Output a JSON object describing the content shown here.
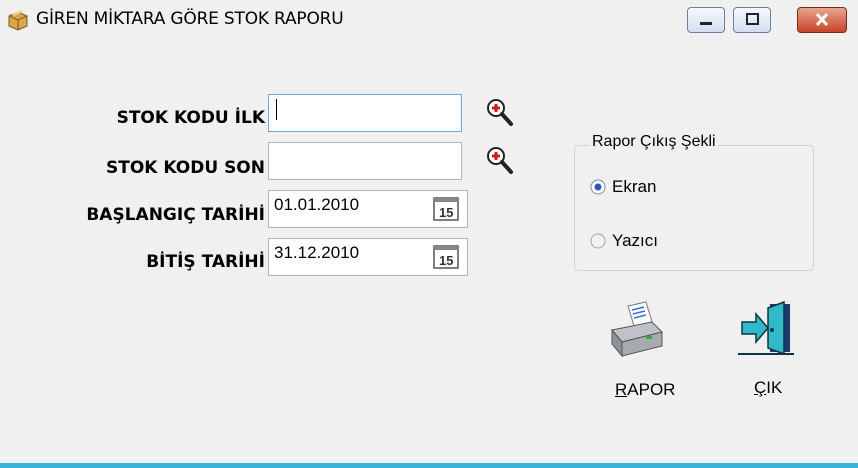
{
  "window": {
    "title": "GİREN MİKTARA GÖRE STOK RAPORU"
  },
  "form": {
    "stok_kodu_ilk": {
      "label": "STOK KODU İLK",
      "value": ""
    },
    "stok_kodu_son": {
      "label": "STOK KODU SON",
      "value": ""
    },
    "baslangic_tarihi": {
      "label": "BAŞLANGIÇ TARİHİ",
      "value": "01.01.2010"
    },
    "bitis_tarihi": {
      "label": "BİTİŞ TARİHİ",
      "value": "31.12.2010"
    }
  },
  "output_group": {
    "title": "Rapor Çıkış Şekli",
    "options": [
      {
        "label": "Ekran",
        "selected": true
      },
      {
        "label": "Yazıcı",
        "selected": false
      }
    ]
  },
  "buttons": {
    "rapor": {
      "accel": "R",
      "rest": "APOR"
    },
    "cik": {
      "accel": "Ç",
      "rest": "IK"
    }
  },
  "icons": {
    "lookup": "magnifier-plus-icon",
    "calendar": "calendar-icon",
    "print": "printer-icon",
    "exit": "exit-door-icon"
  },
  "colors": {
    "accent": "#3ab3d8",
    "close": "#c8442a"
  }
}
